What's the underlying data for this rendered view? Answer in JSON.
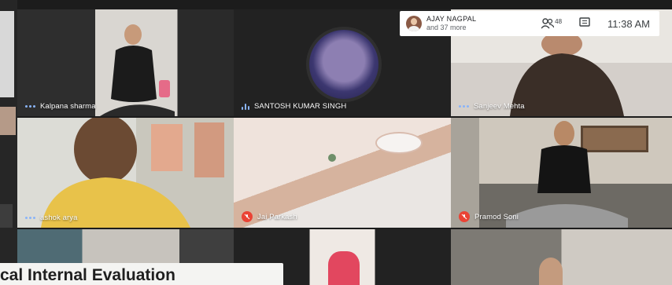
{
  "meeting": {
    "host_name": "AJAY NAGPAL",
    "others": "and 37 more",
    "participant_count": "48",
    "time": "11:38 AM"
  },
  "tiles": [
    {
      "name": "Kalpana sharma",
      "audio": "speaking-dots"
    },
    {
      "name": "SANTOSH KUMAR SINGH",
      "audio": "level"
    },
    {
      "name": "Sanjeev Mehta",
      "audio": "speaking-dots"
    },
    {
      "name": "ashok arya",
      "audio": "speaking-dots"
    },
    {
      "name": "Jai Parkash",
      "audio": "muted"
    },
    {
      "name": "Pramod Soni",
      "audio": "muted"
    }
  ],
  "caption": "cal Internal Evaluation",
  "colors": {
    "accent": "#8ab4f8",
    "muted": "#ea4335"
  }
}
